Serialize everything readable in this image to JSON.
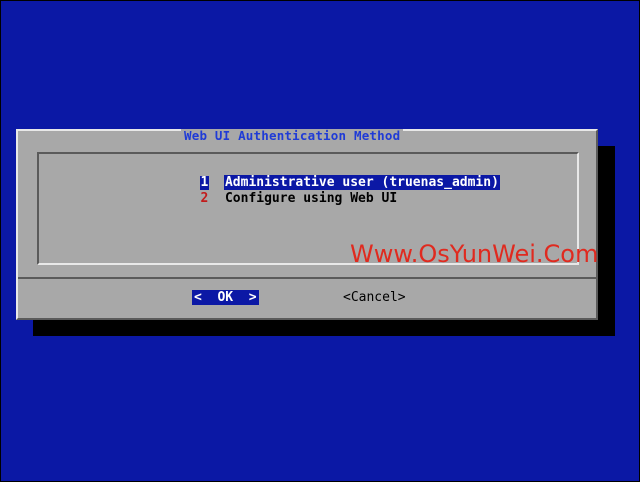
{
  "dialog": {
    "title": "Web UI Authentication Method",
    "menu": [
      {
        "tag": "1",
        "label": "Administrative user (truenas_admin)",
        "selected": true
      },
      {
        "tag": "2",
        "label": "Configure using Web UI",
        "selected": false
      }
    ],
    "buttons": {
      "ok_label": "<  OK  >",
      "cancel_label": "<Cancel>"
    }
  },
  "watermark": "Www.OsYunWei.Com",
  "colors": {
    "background": "#0b18a5",
    "dialog": "#a8a8a8",
    "title": "#1f3bd6",
    "tag": "#c21b1b",
    "watermark": "#e02a1f"
  }
}
